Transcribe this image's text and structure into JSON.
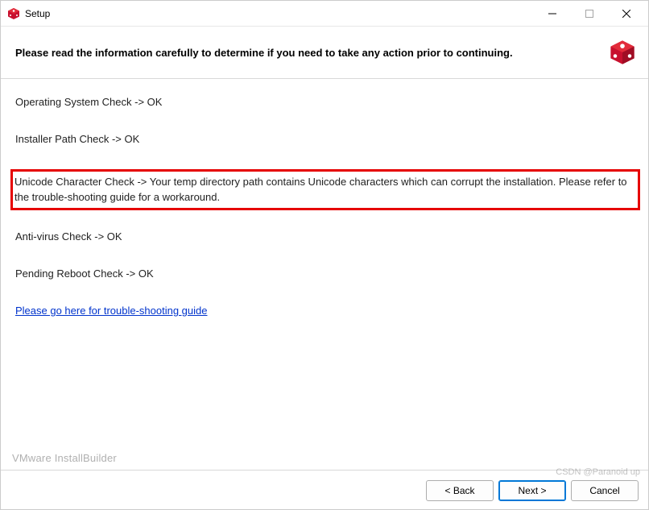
{
  "titlebar": {
    "title": "Setup"
  },
  "header": {
    "text": "Please read the information carefully to determine if you need to take any action prior to continuing."
  },
  "checks": {
    "os": "Operating System Check -> OK",
    "installer_path": "Installer Path Check -> OK",
    "unicode": "Unicode Character Check ->  Your temp directory path contains Unicode characters which can corrupt the installation. Please refer to the trouble-shooting guide for a workaround.",
    "antivirus": "Anti-virus Check -> OK",
    "reboot": "Pending Reboot Check -> OK"
  },
  "link": {
    "troubleshoot": "Please go here for trouble-shooting guide"
  },
  "footer": {
    "vendor": "VMware InstallBuilder",
    "watermark": "CSDN @Paranoid up"
  },
  "buttons": {
    "back": "< Back",
    "next": "Next >",
    "cancel": "Cancel"
  },
  "colors": {
    "accent_red": "#c8102e",
    "highlight_red": "#e60000",
    "link_blue": "#0033cc"
  }
}
